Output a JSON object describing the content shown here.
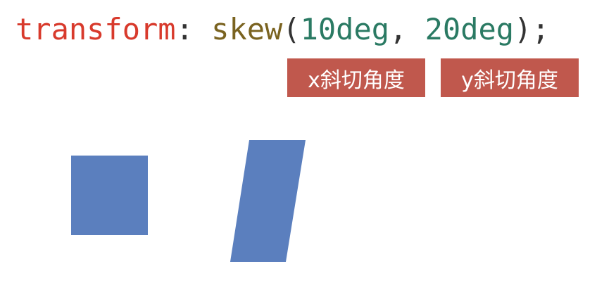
{
  "code": {
    "property": "transform",
    "colon": ": ",
    "function_name": "skew",
    "open_paren": "(",
    "arg_x": "10deg",
    "separator": ", ",
    "arg_y": "20deg",
    "close": ");"
  },
  "labels": {
    "x_angle": "x斜切角度",
    "y_angle": "y斜切角度"
  },
  "colors": {
    "property": "#d83a2c",
    "function": "#7a6320",
    "number": "#2a7a63",
    "label_background": "#c0584d",
    "shape_fill": "#5b7fbe"
  }
}
